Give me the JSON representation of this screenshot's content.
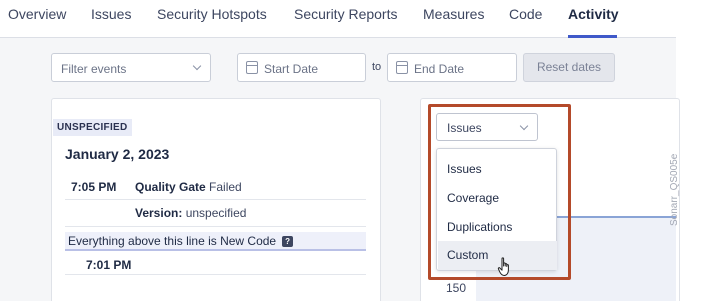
{
  "nav": {
    "tabs": [
      {
        "label": "Overview"
      },
      {
        "label": "Issues"
      },
      {
        "label": "Security Hotspots"
      },
      {
        "label": "Security Reports"
      },
      {
        "label": "Measures"
      },
      {
        "label": "Code"
      },
      {
        "label": "Activity",
        "active": true
      }
    ]
  },
  "filters": {
    "filter_placeholder": "Filter events",
    "start_placeholder": "Start Date",
    "to_label": "to",
    "end_placeholder": "End Date",
    "reset_label": "Reset dates"
  },
  "activity": {
    "version_badge": "UNSPECIFIED",
    "date": "January 2, 2023",
    "events": [
      {
        "time": "7:05 PM",
        "label": "Quality Gate",
        "value": "Failed"
      }
    ],
    "version_label": "Version:",
    "version_value": "unspecified",
    "new_code_text": "Everything above this line is New Code",
    "help_glyph": "?",
    "next_time": "7:01 PM"
  },
  "graph": {
    "selected": "Issues",
    "options": [
      {
        "label": "Issues"
      },
      {
        "label": "Coverage"
      },
      {
        "label": "Duplications"
      },
      {
        "label": "Custom",
        "hovered": true
      }
    ],
    "axis_tick": "150"
  },
  "watermark": "Sonarr_QS005e",
  "colors": {
    "accent": "#3f59c9",
    "highlight_border": "#b44a2a",
    "panel_bg": "#f5f6f8"
  }
}
